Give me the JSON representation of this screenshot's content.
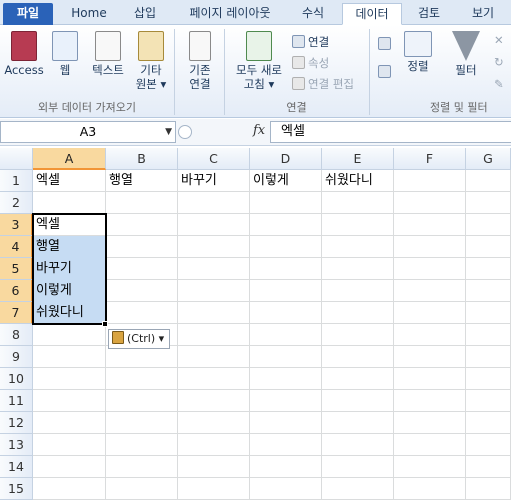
{
  "tabs": [
    "파일",
    "Home",
    "삽입",
    "페이지 레이아웃",
    "수식",
    "데이터",
    "검토",
    "보기"
  ],
  "ribbon": {
    "access": "Access",
    "web": "웹",
    "text": "텍스트",
    "other_line1": "기타",
    "other_line2": "원본 ▾",
    "existing_line1": "기존",
    "existing_line2": "연결",
    "group_external": "외부 데이터 가져오기",
    "refresh_line1": "모두 새로",
    "refresh_line2": "고침 ▾",
    "connections": "연결",
    "properties": "속성",
    "edit_links": "연결 편집",
    "group_connections": "연결",
    "sort": "정렬",
    "filter": "필터",
    "group_sortfilter": "정렬 및 필터"
  },
  "formula_bar": {
    "name_box": "A3",
    "fx": "fx",
    "formula": "엑셀"
  },
  "columns": [
    "A",
    "B",
    "C",
    "D",
    "E",
    "F",
    "G"
  ],
  "rows": [
    "1",
    "2",
    "3",
    "4",
    "5",
    "6",
    "7",
    "8",
    "9",
    "10",
    "11",
    "12",
    "13",
    "14",
    "15"
  ],
  "cells": {
    "A1": "엑셀",
    "B1": "행열",
    "C1": "바꾸기",
    "D1": "이렇게",
    "E1": "쉬웠다니",
    "A3": "엑셀",
    "A4": "행열",
    "A5": "바꾸기",
    "A6": "이렇게",
    "A7": "쉬웠다니"
  },
  "paste_options": {
    "label": "(Ctrl) ▾"
  }
}
